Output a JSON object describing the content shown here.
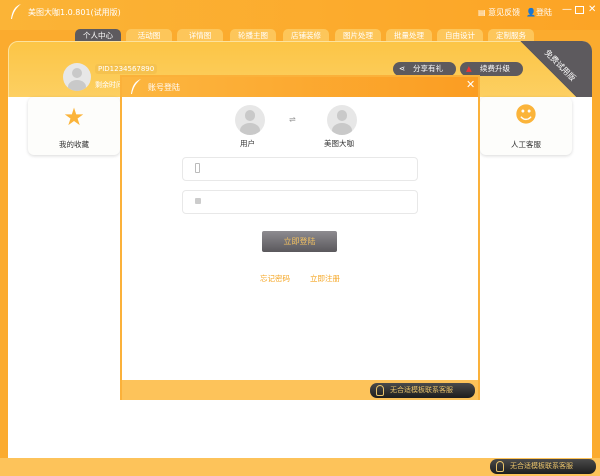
{
  "app": {
    "title": "美图大咖1.0.801(试用版)",
    "feedback": "意见反馈",
    "login": "登陆"
  },
  "tabs": [
    "个人中心",
    "活动图",
    "详情图",
    "轮播主图",
    "店铺装修",
    "图片处理",
    "批量处理",
    "自由设计",
    "定制服务"
  ],
  "profile": {
    "pid": "PID1234567890",
    "remaining": "剩余时间",
    "share": "分享有礼",
    "upgrade": "续费升级",
    "ribbon": "免费试用版"
  },
  "cards": {
    "favorites": "我的收藏",
    "service": "人工客服"
  },
  "modal": {
    "title": "账号登陆",
    "user_label": "用户",
    "brand_label": "美图大咖",
    "swap": "⇌",
    "phone_placeholder": "",
    "password_placeholder": "",
    "login_button": "立即登陆",
    "forgot": "忘记密码",
    "register": "立即注册",
    "contact": "无合适模板联系客服"
  },
  "footer": {
    "contact": "无合适模板联系客服"
  }
}
